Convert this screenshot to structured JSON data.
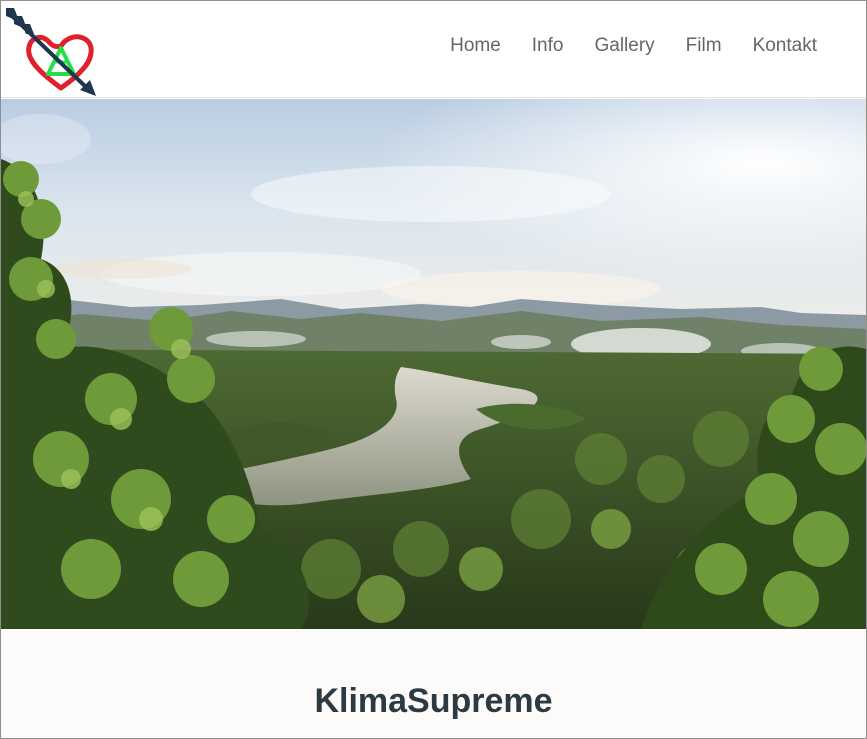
{
  "header": {
    "logo_icon": "heart-arrow-recycle-icon",
    "nav": [
      {
        "label": "Home"
      },
      {
        "label": "Info"
      },
      {
        "label": "Gallery"
      },
      {
        "label": "Film"
      },
      {
        "label": "Kontakt"
      }
    ]
  },
  "hero": {
    "image": "rainforest-lake-landscape"
  },
  "main": {
    "title": "KlimaSupreme"
  },
  "colors": {
    "nav_text": "#666666",
    "title_text": "#2e3a42",
    "logo_heart": "#e0202b",
    "logo_triangle": "#22e04a",
    "logo_arrow": "#1f3550"
  }
}
